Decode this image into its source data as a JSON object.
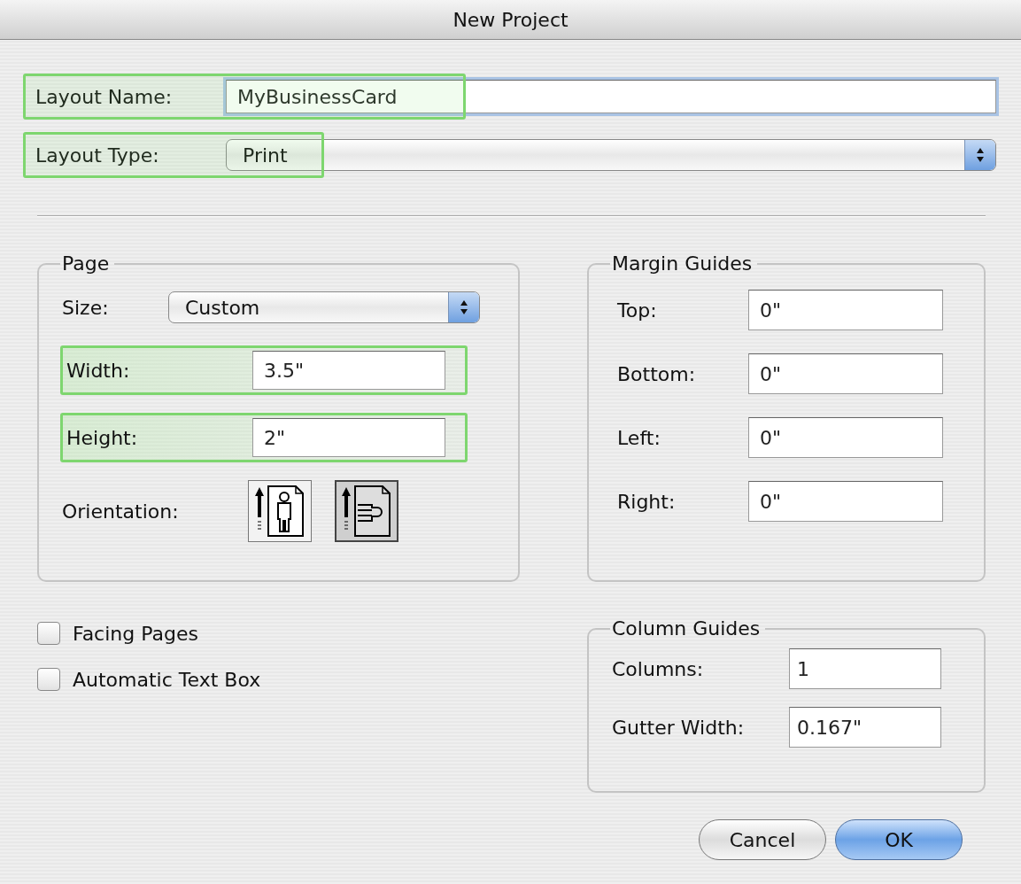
{
  "window": {
    "title": "New Project"
  },
  "layout_name": {
    "label": "Layout Name:",
    "value": "MyBusinessCard",
    "highlighted": true
  },
  "layout_type": {
    "label": "Layout Type:",
    "value": "Print",
    "highlighted": true
  },
  "page": {
    "title": "Page",
    "size": {
      "label": "Size:",
      "value": "Custom"
    },
    "fields": [
      {
        "label": "Width:",
        "value": "3.5\"",
        "highlighted": true
      },
      {
        "label": "Height:",
        "value": "2\"",
        "highlighted": true
      }
    ],
    "orientation": {
      "label": "Orientation:",
      "options": [
        {
          "kind": "portrait",
          "selected": false
        },
        {
          "kind": "landscape",
          "selected": true
        }
      ]
    }
  },
  "margin_guides": {
    "title": "Margin Guides",
    "fields": [
      {
        "label": "Top:",
        "value": "0\""
      },
      {
        "label": "Bottom:",
        "value": "0\""
      },
      {
        "label": "Left:",
        "value": "0\""
      },
      {
        "label": "Right:",
        "value": "0\""
      }
    ]
  },
  "checkboxes": [
    {
      "label": "Facing Pages",
      "checked": false
    },
    {
      "label": "Automatic Text Box",
      "checked": false
    }
  ],
  "column_guides": {
    "title": "Column Guides",
    "fields": [
      {
        "label": "Columns:",
        "value": "1"
      },
      {
        "label": "Gutter Width:",
        "value": "0.167\""
      }
    ]
  },
  "buttons": [
    {
      "label": "Cancel",
      "kind": "cancel"
    },
    {
      "label": "OK",
      "kind": "default"
    }
  ]
}
